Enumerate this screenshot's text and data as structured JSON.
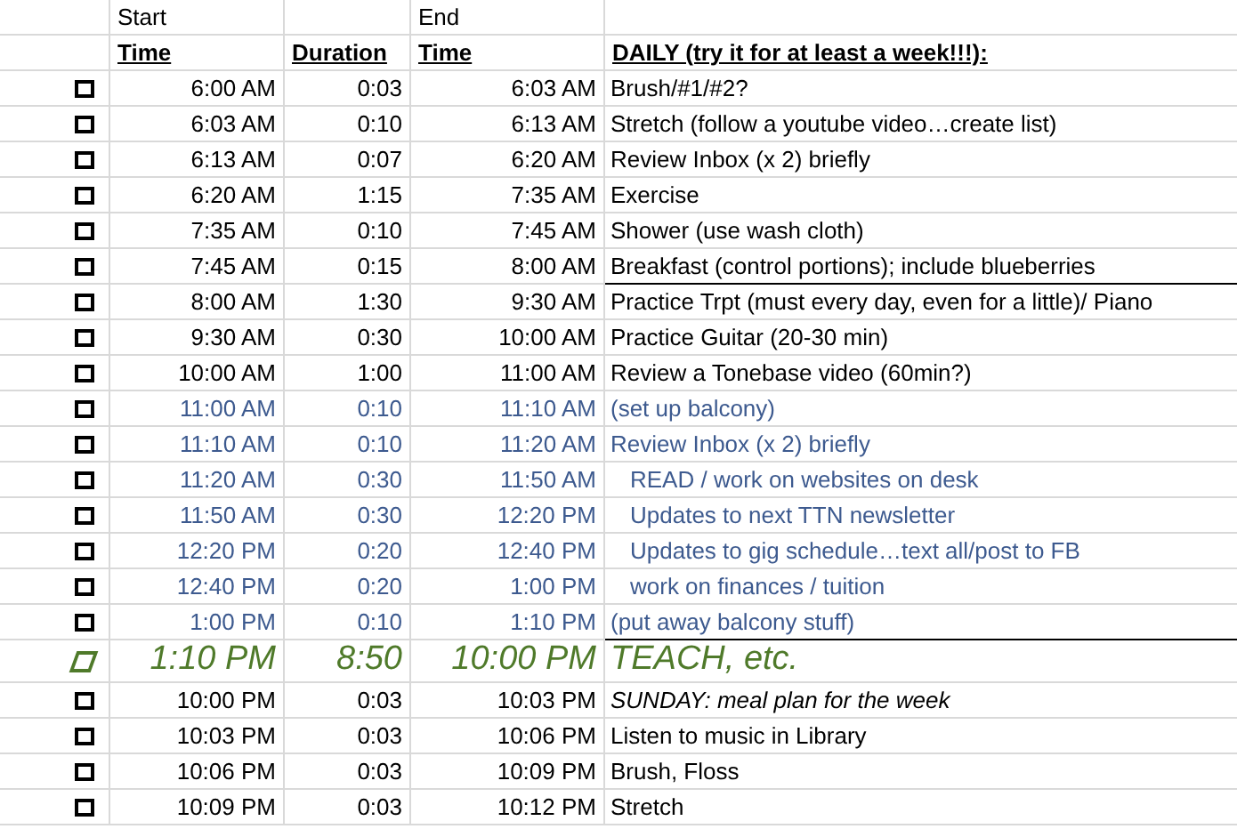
{
  "header_top": {
    "start": "Start",
    "end": "End"
  },
  "header": {
    "start_time": "Time",
    "duration": "Duration",
    "end_time": "Time",
    "task": "DAILY (try it for at least a week!!!):"
  },
  "rows": [
    {
      "kind": "normal",
      "start": "6:00 AM",
      "duration": "0:03",
      "end": "6:03 AM",
      "task": "Brush/#1/#2?",
      "indented": false,
      "italic": false,
      "rule_below": false
    },
    {
      "kind": "normal",
      "start": "6:03 AM",
      "duration": "0:10",
      "end": "6:13 AM",
      "task": "Stretch (follow a youtube video…create list)",
      "indented": false,
      "italic": false,
      "rule_below": false
    },
    {
      "kind": "normal",
      "start": "6:13 AM",
      "duration": "0:07",
      "end": "6:20 AM",
      "task": "Review Inbox (x 2) briefly",
      "indented": false,
      "italic": false,
      "rule_below": false
    },
    {
      "kind": "normal",
      "start": "6:20 AM",
      "duration": "1:15",
      "end": "7:35 AM",
      "task": "Exercise",
      "indented": false,
      "italic": false,
      "rule_below": false
    },
    {
      "kind": "normal",
      "start": "7:35 AM",
      "duration": "0:10",
      "end": "7:45 AM",
      "task": "Shower (use wash cloth)",
      "indented": false,
      "italic": false,
      "rule_below": false
    },
    {
      "kind": "normal",
      "start": "7:45 AM",
      "duration": "0:15",
      "end": "8:00 AM",
      "task": "Breakfast (control portions); include blueberries",
      "indented": false,
      "italic": false,
      "rule_below": true
    },
    {
      "kind": "normal",
      "start": "8:00 AM",
      "duration": "1:30",
      "end": "9:30 AM",
      "task": "Practice Trpt (must every day, even for a little)/ Piano",
      "indented": false,
      "italic": false,
      "rule_below": false
    },
    {
      "kind": "normal",
      "start": "9:30 AM",
      "duration": "0:30",
      "end": "10:00 AM",
      "task": "Practice Guitar (20-30 min)",
      "indented": false,
      "italic": false,
      "rule_below": false
    },
    {
      "kind": "normal",
      "start": "10:00 AM",
      "duration": "1:00",
      "end": "11:00 AM",
      "task": "Review a Tonebase video (60min?)",
      "indented": false,
      "italic": false,
      "rule_below": false
    },
    {
      "kind": "blue",
      "start": "11:00 AM",
      "duration": "0:10",
      "end": "11:10 AM",
      "task": "(set up balcony)",
      "indented": false,
      "italic": false,
      "rule_below": false
    },
    {
      "kind": "blue",
      "start": "11:10 AM",
      "duration": "0:10",
      "end": "11:20 AM",
      "task": "Review Inbox (x 2) briefly",
      "indented": false,
      "italic": false,
      "rule_below": false
    },
    {
      "kind": "blue",
      "start": "11:20 AM",
      "duration": "0:30",
      "end": "11:50 AM",
      "task": "READ / work on websites on desk",
      "indented": true,
      "italic": false,
      "rule_below": false
    },
    {
      "kind": "blue",
      "start": "11:50 AM",
      "duration": "0:30",
      "end": "12:20 PM",
      "task": "Updates to next TTN newsletter",
      "indented": true,
      "italic": false,
      "rule_below": false
    },
    {
      "kind": "blue",
      "start": "12:20 PM",
      "duration": "0:20",
      "end": "12:40 PM",
      "task": "Updates to gig schedule…text all/post to FB",
      "indented": true,
      "italic": false,
      "rule_below": false
    },
    {
      "kind": "blue",
      "start": "12:40 PM",
      "duration": "0:20",
      "end": "1:00 PM",
      "task": "work on finances / tuition",
      "indented": true,
      "italic": false,
      "rule_below": false
    },
    {
      "kind": "blue",
      "start": "1:00 PM",
      "duration": "0:10",
      "end": "1:10 PM",
      "task": "(put away balcony stuff)",
      "indented": false,
      "italic": false,
      "rule_below": true
    },
    {
      "kind": "teach",
      "start": "1:10 PM",
      "duration": "8:50",
      "end": "10:00 PM",
      "task": "TEACH, etc.",
      "indented": false,
      "italic": true,
      "rule_below": false
    },
    {
      "kind": "normal",
      "start": "10:00 PM",
      "duration": "0:03",
      "end": "10:03 PM",
      "task": "SUNDAY:  meal plan for the week",
      "indented": false,
      "italic": true,
      "rule_below": false
    },
    {
      "kind": "normal",
      "start": "10:03 PM",
      "duration": "0:03",
      "end": "10:06 PM",
      "task": "Listen to music in Library",
      "indented": false,
      "italic": false,
      "rule_below": false
    },
    {
      "kind": "normal",
      "start": "10:06 PM",
      "duration": "0:03",
      "end": "10:09 PM",
      "task": "Brush, Floss",
      "indented": false,
      "italic": false,
      "rule_below": false
    },
    {
      "kind": "normal",
      "start": "10:09 PM",
      "duration": "0:03",
      "end": "10:12 PM",
      "task": "Stretch",
      "indented": false,
      "italic": false,
      "rule_below": false
    }
  ]
}
